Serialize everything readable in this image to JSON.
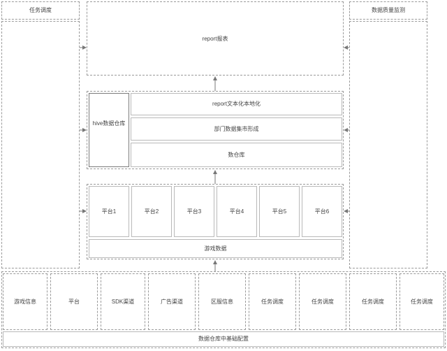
{
  "left_panel": {
    "title": "任务调度"
  },
  "right_panel": {
    "title": "数据质量监测"
  },
  "report_display": {
    "label": "report报表"
  },
  "hive": {
    "label": "hive数据仓库"
  },
  "layers": {
    "report_text": "report文本化本地化",
    "dept_data": "部门数据集市形成",
    "warehouse": "数仓库"
  },
  "platforms": [
    "平台1",
    "平台2",
    "平台3",
    "平台4",
    "平台5",
    "平台6"
  ],
  "game_data": {
    "label": "游戏数据"
  },
  "sources": [
    "游戏信息",
    "平台",
    "SDK渠道",
    "广告渠道",
    "区服信息",
    "任务调度",
    "任务调度",
    "任务调度",
    "任务调度"
  ],
  "foundation": {
    "label": "数据仓库中基础配置"
  }
}
